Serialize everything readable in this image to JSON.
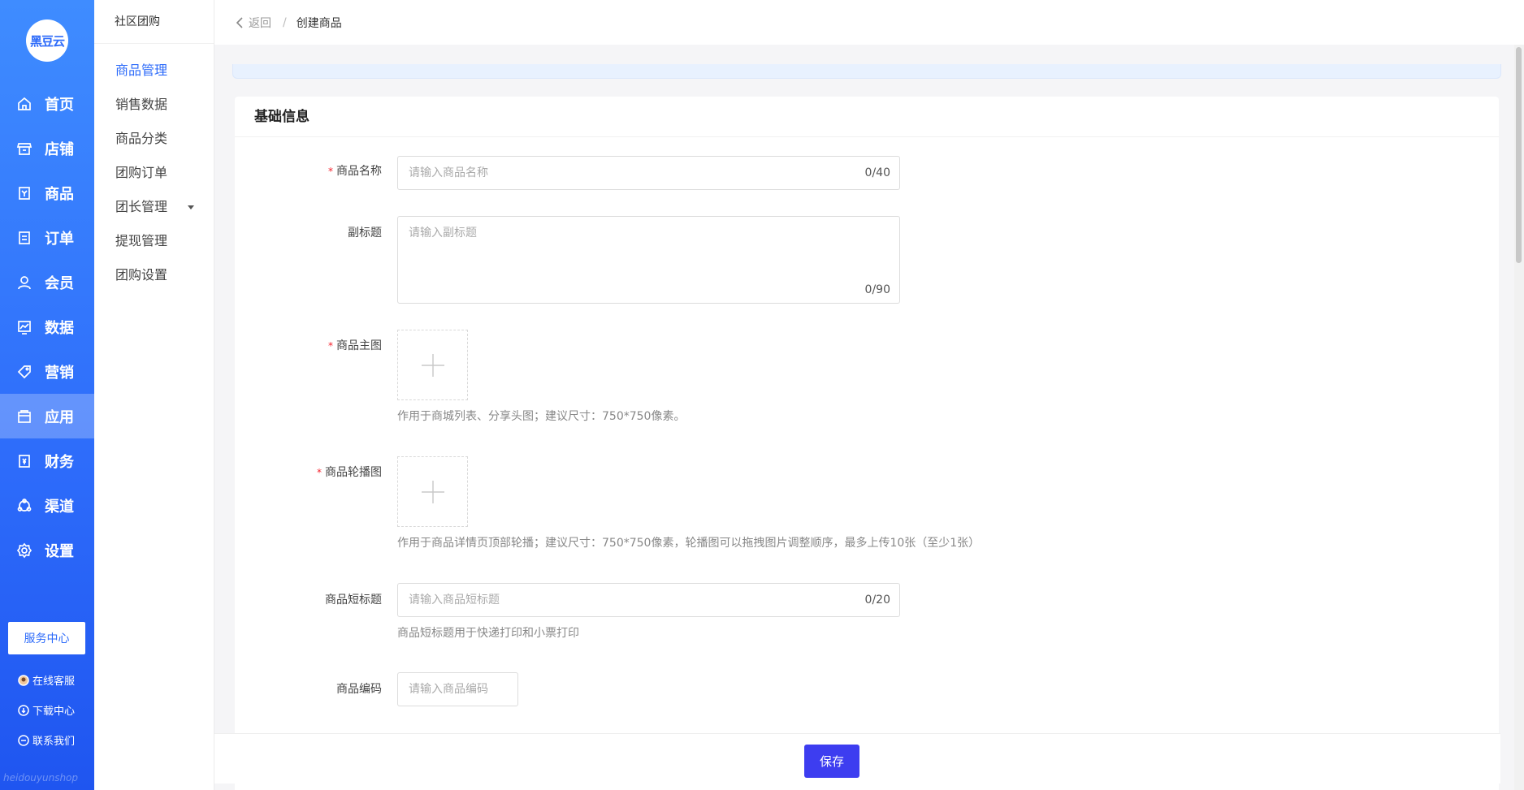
{
  "logo": {
    "text": "黑豆云"
  },
  "primary_nav": [
    {
      "label": "首页",
      "icon": "home-icon"
    },
    {
      "label": "店铺",
      "icon": "store-icon"
    },
    {
      "label": "商品",
      "icon": "product-icon"
    },
    {
      "label": "订单",
      "icon": "order-icon"
    },
    {
      "label": "会员",
      "icon": "member-icon"
    },
    {
      "label": "数据",
      "icon": "chart-icon"
    },
    {
      "label": "营销",
      "icon": "tag-icon"
    },
    {
      "label": "应用",
      "icon": "app-icon",
      "active": true
    },
    {
      "label": "财务",
      "icon": "finance-icon"
    },
    {
      "label": "渠道",
      "icon": "channel-icon"
    },
    {
      "label": "设置",
      "icon": "settings-icon"
    }
  ],
  "service_center": "服务中心",
  "sidebar_links": {
    "online_service": "在线客服",
    "download_center": "下载中心",
    "contact_us": "联系我们"
  },
  "watermark": "heidouyunshop",
  "secondary_nav": {
    "title": "社区团购",
    "items": [
      {
        "label": "商品管理",
        "active": true
      },
      {
        "label": "销售数据"
      },
      {
        "label": "商品分类"
      },
      {
        "label": "团购订单"
      },
      {
        "label": "团长管理",
        "has_dropdown": true
      },
      {
        "label": "提现管理"
      },
      {
        "label": "团购设置"
      }
    ]
  },
  "breadcrumb": {
    "back": "返回",
    "separator": "/",
    "current": "创建商品"
  },
  "section": {
    "title": "基础信息"
  },
  "form": {
    "name": {
      "label": "商品名称",
      "required": "*",
      "placeholder": "请输入商品名称",
      "counter": "0/40"
    },
    "subtitle": {
      "label": "副标题",
      "placeholder": "请输入副标题",
      "counter": "0/90"
    },
    "main_image": {
      "label": "商品主图",
      "required": "*",
      "hint": "作用于商城列表、分享头图；建议尺寸：750*750像素。"
    },
    "carousel": {
      "label": "商品轮播图",
      "required": "*",
      "hint": "作用于商品详情页顶部轮播；建议尺寸：750*750像素，轮播图可以拖拽图片调整顺序，最多上传10张（至少1张）"
    },
    "short_title": {
      "label": "商品短标题",
      "placeholder": "请输入商品短标题",
      "counter": "0/20",
      "hint": "商品短标题用于快递打印和小票打印"
    },
    "code": {
      "label": "商品编码",
      "placeholder": "请输入商品编码"
    }
  },
  "actions": {
    "save": "保存"
  },
  "colors": {
    "primary": "#2d6bfa",
    "save_button": "#3d3df0",
    "required": "#f5222d"
  }
}
